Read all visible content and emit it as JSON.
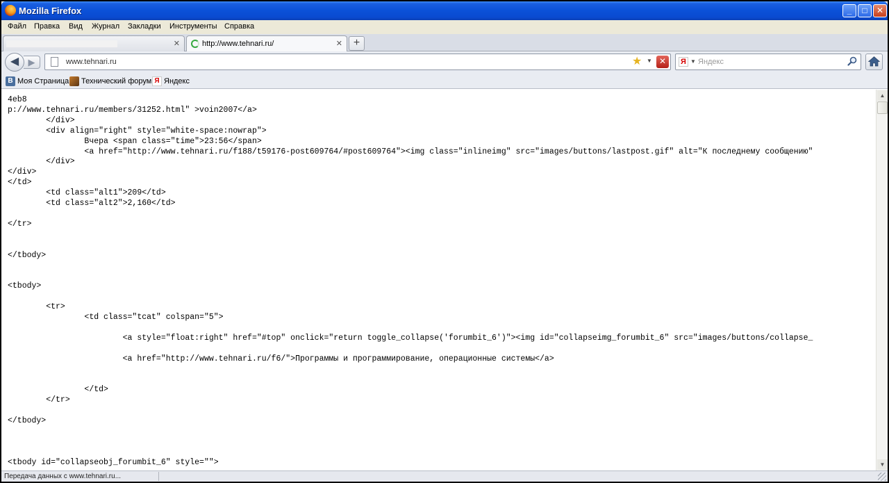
{
  "window": {
    "title": "Mozilla Firefox",
    "controls": {
      "minimize": "_",
      "maximize": "□",
      "close": "✕"
    }
  },
  "menu": [
    "Файл",
    "Правка",
    "Вид",
    "Журнал",
    "Закладки",
    "Инструменты",
    "Справка"
  ],
  "tabs": [
    {
      "title": "",
      "active": false,
      "close": "✕"
    },
    {
      "title": "http://www.tehnari.ru/",
      "active": true,
      "close": "✕"
    }
  ],
  "new_tab_label": "+",
  "nav": {
    "back": "◀",
    "forward": "▶",
    "url": "www.tehnari.ru",
    "stop": "✕",
    "star": "★",
    "dropdown": "▼"
  },
  "search": {
    "engine_letter": "Я",
    "placeholder": "Яндекс",
    "dropdown": "▼"
  },
  "bookmarks": [
    {
      "icon": "vk-icon",
      "icon_text": "В",
      "label": "Моя Страница"
    },
    {
      "icon": "forum-icon",
      "icon_text": "",
      "label": "Технический форум"
    },
    {
      "icon": "yandex-icon",
      "icon_text": "Я",
      "label": "Яндекс"
    }
  ],
  "source_lines": [
    "4eb8",
    "p://www.tehnari.ru/members/31252.html\" >voin2007</a>",
    "        </div>",
    "        <div align=\"right\" style=\"white-space:nowrap\">",
    "                Вчера <span class=\"time\">23:56</span>",
    "                <a href=\"http://www.tehnari.ru/f188/t59176-post609764/#post609764\"><img class=\"inlineimg\" src=\"images/buttons/lastpost.gif\" alt=\"К последнему сообщению\"",
    "        </div>",
    "</div>",
    "</td>",
    "        <td class=\"alt1\">209</td>",
    "        <td class=\"alt2\">2,160</td>",
    "",
    "</tr>",
    "",
    "",
    "</tbody>",
    "",
    "",
    "<tbody>",
    "",
    "        <tr>",
    "                <td class=\"tcat\" colspan=\"5\">",
    "",
    "                        <a style=\"float:right\" href=\"#top\" onclick=\"return toggle_collapse('forumbit_6')\"><img id=\"collapseimg_forumbit_6\" src=\"images/buttons/collapse_",
    "",
    "                        <a href=\"http://www.tehnari.ru/f6/\">Программы и программирование, операционные системы</a>",
    "",
    "",
    "                </td>",
    "        </tr>",
    "",
    "</tbody>",
    "",
    "",
    "",
    "<tbody id=\"collapseobj_forumbit_6\" style=\"\">"
  ],
  "scrollbar": {
    "up": "▲",
    "down": "▼"
  },
  "status": {
    "text": "Передача данных с www.tehnari.ru..."
  }
}
